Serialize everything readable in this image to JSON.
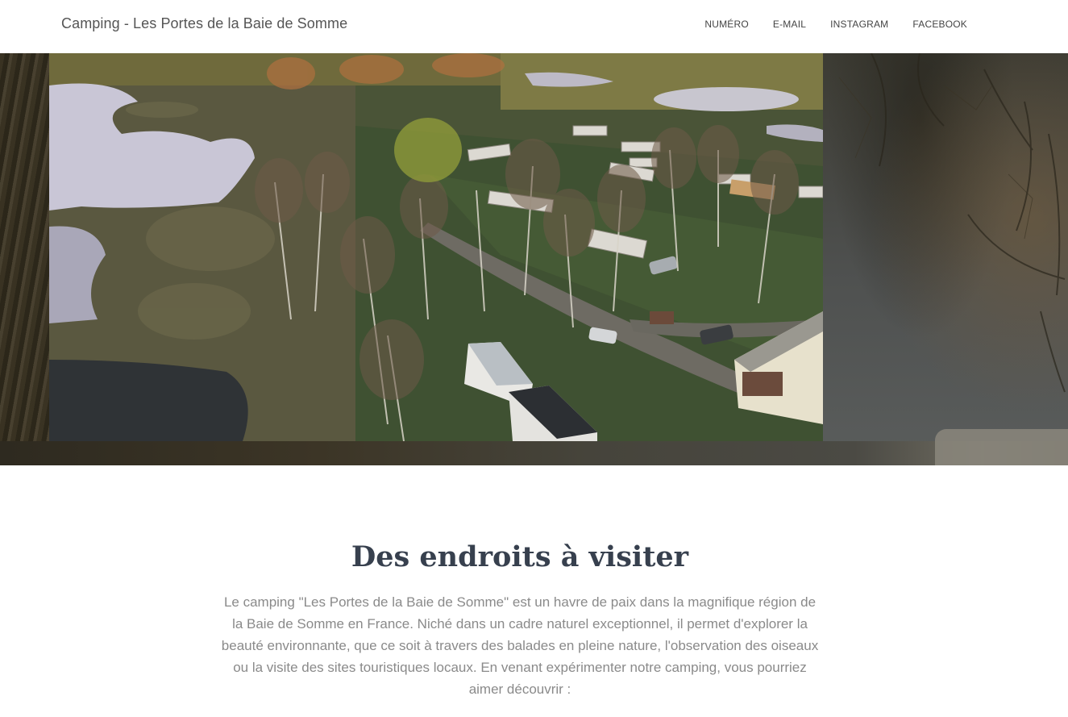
{
  "navbar": {
    "brand": "Camping - Les Portes de la Baie de Somme",
    "links": [
      {
        "label": "NUMÉRO"
      },
      {
        "label": "E-MAIL"
      },
      {
        "label": "INSTAGRAM"
      },
      {
        "label": "FACEBOOK"
      }
    ]
  },
  "hero": {
    "image": "aerial-view-of-campsite-with-ponds-and-mobile-homes"
  },
  "section": {
    "title": "Des endroits à visiter",
    "text": "Le camping \"Les Portes de la Baie de Somme\" est un havre de paix dans la magnifique région de la Baie de Somme en France. Niché dans un cadre naturel exceptionnel, il permet d'explorer la beauté environnante, que ce soit à travers des balades en pleine nature, l'observation des oiseaux ou la visite des sites touristiques locaux. En venant expérimenter notre camping, vous pourriez aimer découvrir :"
  },
  "colors": {
    "title": "#37404e",
    "body_text": "#8a8a8a",
    "nav_text": "#444444",
    "brand_text": "#555555"
  }
}
